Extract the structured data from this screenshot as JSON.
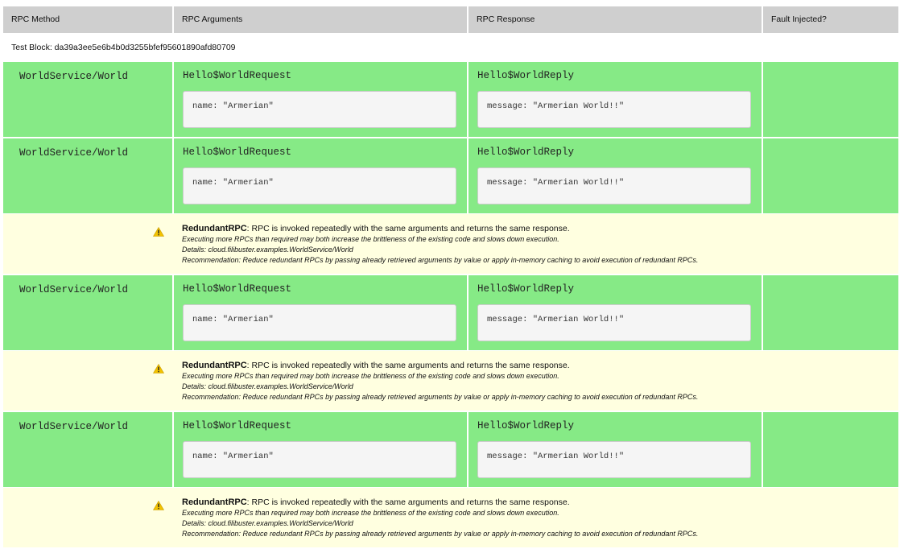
{
  "header": {
    "columns": [
      "RPC Method",
      "RPC Arguments",
      "RPC Response",
      "Fault Injected?"
    ]
  },
  "test_block": "Test Block: da39a3ee5e6b4b0d3255bfef95601890afd80709",
  "rows": [
    {
      "method": "WorldService/World",
      "request_type": "Hello$WorldRequest",
      "request_body": "name: \"Armerian\"",
      "response_type": "Hello$WorldReply",
      "response_body": "message: \"Armerian World!!\"",
      "fault": ""
    },
    {
      "method": "WorldService/World",
      "request_type": "Hello$WorldRequest",
      "request_body": "name: \"Armerian\"",
      "response_type": "Hello$WorldReply",
      "response_body": "message: \"Armerian World!!\"",
      "fault": ""
    },
    {
      "warning": {
        "icon": "warning-icon",
        "title": "RedundantRPC",
        "summary": ": RPC is invoked repeatedly with the same arguments and returns the same response.",
        "impact": "Executing more RPCs than required may both increase the brittleness of the existing code and slows down execution.",
        "details": "Details: cloud.filibuster.examples.WorldService/World",
        "recommendation": "Recommendation: Reduce redundant RPCs by passing already retrieved arguments by value or apply in-memory caching to avoid execution of redundant RPCs."
      }
    },
    {
      "method": "WorldService/World",
      "request_type": "Hello$WorldRequest",
      "request_body": "name: \"Armerian\"",
      "response_type": "Hello$WorldReply",
      "response_body": "message: \"Armerian World!!\"",
      "fault": ""
    },
    {
      "warning": {
        "icon": "warning-icon",
        "title": "RedundantRPC",
        "summary": ": RPC is invoked repeatedly with the same arguments and returns the same response.",
        "impact": "Executing more RPCs than required may both increase the brittleness of the existing code and slows down execution.",
        "details": "Details: cloud.filibuster.examples.WorldService/World",
        "recommendation": "Recommendation: Reduce redundant RPCs by passing already retrieved arguments by value or apply in-memory caching to avoid execution of redundant RPCs."
      }
    },
    {
      "method": "WorldService/World",
      "request_type": "Hello$WorldRequest",
      "request_body": "name: \"Armerian\"",
      "response_type": "Hello$WorldReply",
      "response_body": "message: \"Armerian World!!\"",
      "fault": ""
    },
    {
      "warning": {
        "icon": "warning-icon",
        "title": "RedundantRPC",
        "summary": ": RPC is invoked repeatedly with the same arguments and returns the same response.",
        "impact": "Executing more RPCs than required may both increase the brittleness of the existing code and slows down execution.",
        "details": "Details: cloud.filibuster.examples.WorldService/World",
        "recommendation": "Recommendation: Reduce redundant RPCs by passing already retrieved arguments by value or apply in-memory caching to avoid execution of redundant RPCs."
      }
    }
  ],
  "colors": {
    "header_bg": "#cfcfcf",
    "rpc_row_bg": "#86ea86",
    "warning_row_bg": "#ffffe0",
    "warning_icon": "#f2c200"
  }
}
